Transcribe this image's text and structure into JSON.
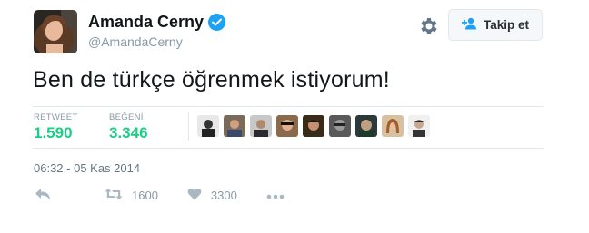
{
  "profile": {
    "name": "Amanda Cerny",
    "handle": "@AmandaCerny",
    "avatar_icon": "profile-photo"
  },
  "header": {
    "follow_label": "Takip et",
    "gear_icon": "gear-icon",
    "follow_icon": "add-user-icon"
  },
  "tweet": {
    "text": "Ben de türkçe öğrenmek istiyorum!",
    "timestamp": "06:32 - 05 Kas 2014"
  },
  "stats": {
    "retweet_label": "RETWEET",
    "retweet_value": "1.590",
    "likes_label": "BEĞENİ",
    "likes_value": "3.346",
    "value_color": "#19cf86"
  },
  "likers": [
    {
      "icon": "liker-avatar-1"
    },
    {
      "icon": "liker-avatar-2"
    },
    {
      "icon": "liker-avatar-3"
    },
    {
      "icon": "liker-avatar-4"
    },
    {
      "icon": "liker-avatar-5"
    },
    {
      "icon": "liker-avatar-6"
    },
    {
      "icon": "liker-avatar-7"
    },
    {
      "icon": "liker-avatar-8"
    },
    {
      "icon": "liker-avatar-9"
    }
  ],
  "actions": {
    "reply_icon": "reply-icon",
    "retweet_icon": "retweet-icon",
    "retweet_count": "1600",
    "like_icon": "heart-icon",
    "like_count": "3300",
    "more_icon": "more-icon"
  },
  "colors": {
    "accent": "#1da1f2",
    "muted": "#8899a6",
    "action_gray": "#aab8c2"
  }
}
